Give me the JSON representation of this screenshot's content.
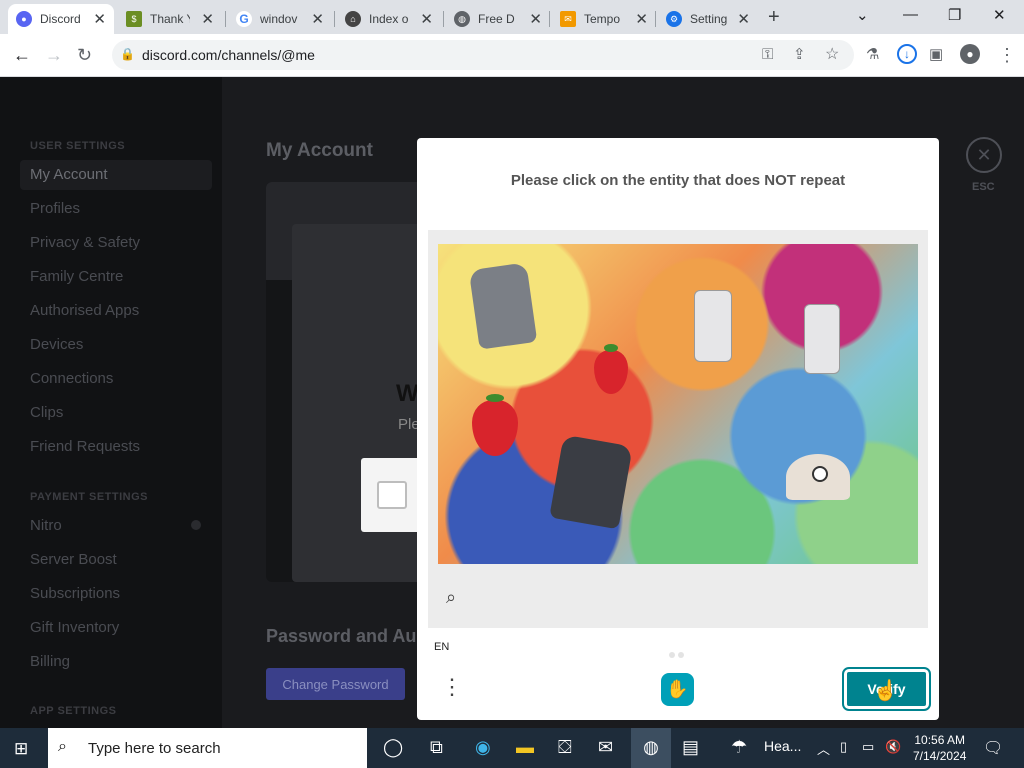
{
  "browser": {
    "tabs": [
      {
        "label": "Discord",
        "icon": "discord-icon",
        "color": "#5865f2"
      },
      {
        "label": "Thank Y",
        "icon": "money-icon",
        "color": "#6b8e23"
      },
      {
        "label": "windov",
        "icon": "google-icon",
        "color": "#4285f4"
      },
      {
        "label": "Index o",
        "icon": "bank-icon",
        "color": "#444444"
      },
      {
        "label": "Free D",
        "icon": "globe-icon",
        "color": "#5f6368"
      },
      {
        "label": "Tempo",
        "icon": "mail-icon",
        "color": "#f29900"
      },
      {
        "label": "Setting",
        "icon": "gear-icon",
        "color": "#1a73e8"
      }
    ],
    "url": "discord.com/channels/@me"
  },
  "discord": {
    "user_settings_header": "USER SETTINGS",
    "nav": [
      "My Account",
      "Profiles",
      "Privacy & Safety",
      "Family Centre",
      "Authorised Apps",
      "Devices",
      "Connections",
      "Clips",
      "Friend Requests"
    ],
    "payment_settings_header": "PAYMENT SETTINGS",
    "payment_nav": [
      "Nitro",
      "Server Boost",
      "Subscriptions",
      "Gift Inventory",
      "Billing"
    ],
    "app_settings_header": "APP SETTINGS",
    "page_title": "My Account",
    "popup_heading_fragment": "W",
    "popup_text_fragment": "Ple",
    "password_section": "Password and Au",
    "change_password": "Change Password",
    "esc_label": "ESC",
    "colors": {
      "sidebar": "#111214",
      "main": "#1a1b1e",
      "blurple": "#3a3f8a"
    }
  },
  "captcha": {
    "prompt": "Please click on the entity that does NOT repeat",
    "language": "EN",
    "verify_label": "Verify",
    "colors": {
      "verify": "#00838f"
    }
  },
  "taskbar": {
    "search_placeholder": "Type here to search",
    "weather": "Hea...",
    "time": "10:56 AM",
    "date": "7/14/2024"
  }
}
